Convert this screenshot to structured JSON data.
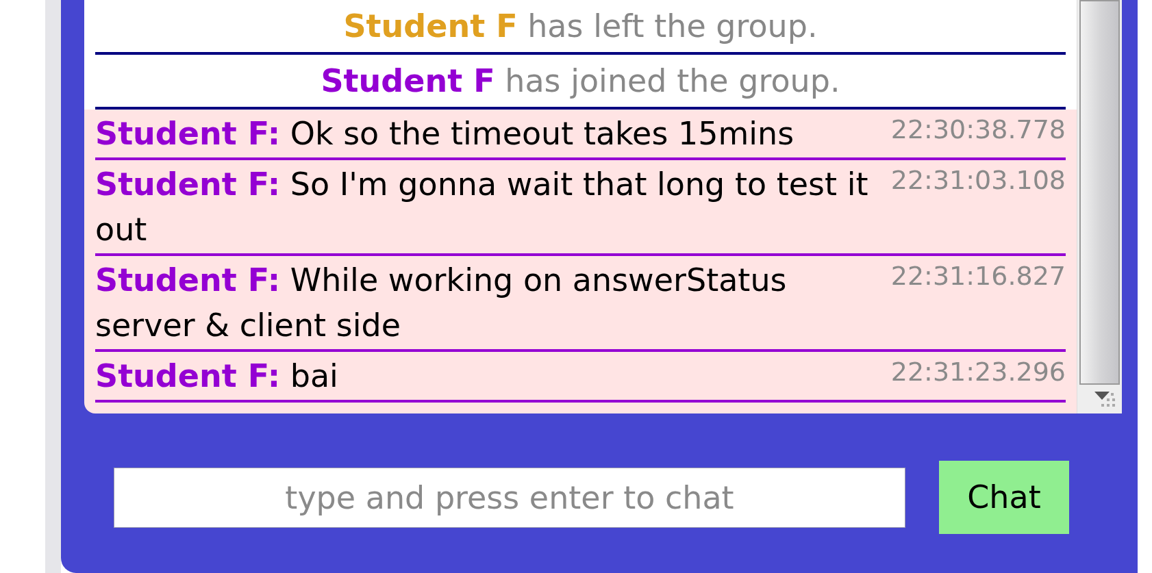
{
  "chat_log": {
    "messages": [
      {
        "kind": "system",
        "sender": "Student F",
        "color": "#e0a020",
        "text": "has left the group."
      },
      {
        "kind": "system",
        "sender": "Student F",
        "color": "#9400d3",
        "text": "has joined the group."
      },
      {
        "kind": "chat",
        "sender": "Student F:",
        "color": "#9400d3",
        "text": "Ok so the timeout takes 15mins",
        "time": "22:30:38.778"
      },
      {
        "kind": "chat",
        "sender": "Student F:",
        "color": "#9400d3",
        "text": "So I'm gonna wait that long to test it out",
        "time": "22:31:03.108"
      },
      {
        "kind": "chat",
        "sender": "Student F:",
        "color": "#9400d3",
        "text": "While working on answerStatus server & client side",
        "time": "22:31:16.827"
      },
      {
        "kind": "chat",
        "sender": "Student F:",
        "color": "#9400d3",
        "text": "bai",
        "time": "22:31:23.296"
      }
    ]
  },
  "chat_input": {
    "placeholder": "type and press enter to chat"
  },
  "send_button": {
    "label": "Chat"
  }
}
